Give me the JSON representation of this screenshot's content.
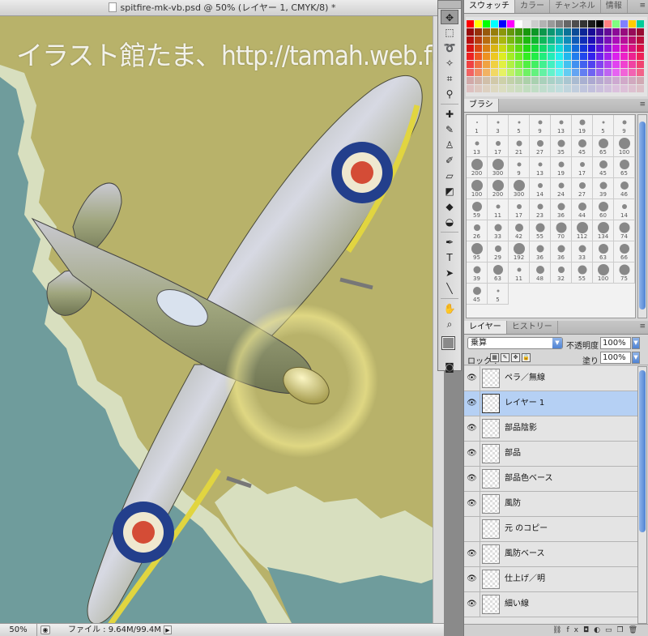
{
  "document": {
    "title": "spitfire-mk-vb.psd @ 50% (レイヤー 1, CMYK/8) *",
    "watermark": "イラスト館たま、http://tamah.web.fc2.com/il.html",
    "zoom": "50%",
    "file_info": "ファイル : 9.64M/99.4M"
  },
  "tools": {
    "icons": [
      "move-icon",
      "marquee-icon",
      "lasso-icon",
      "magic-wand-icon",
      "crop-icon",
      "eyedropper-icon",
      "healing-brush-icon",
      "brush-icon",
      "clone-stamp-icon",
      "history-brush-icon",
      "eraser-icon",
      "paint-bucket-icon",
      "blur-icon",
      "dodge-icon",
      "pen-icon",
      "type-icon",
      "path-select-icon",
      "line-icon",
      "hand-icon",
      "zoom-icon"
    ]
  },
  "swatches_panel": {
    "tabs": [
      "スウォッチ",
      "カラー",
      "チャンネル",
      "情報"
    ],
    "active_tab": 0
  },
  "brush_panel": {
    "tab": "ブラシ",
    "sizes": [
      "1",
      "3",
      "5",
      "9",
      "13",
      "19",
      "5",
      "9",
      "13",
      "17",
      "21",
      "27",
      "35",
      "45",
      "65",
      "100",
      "200",
      "300",
      "9",
      "13",
      "19",
      "17",
      "45",
      "65",
      "100",
      "200",
      "300",
      "14",
      "24",
      "27",
      "39",
      "46",
      "59",
      "11",
      "17",
      "23",
      "36",
      "44",
      "60",
      "14",
      "26",
      "33",
      "42",
      "55",
      "70",
      "112",
      "134",
      "74",
      "95",
      "29",
      "192",
      "36",
      "36",
      "33",
      "63",
      "66",
      "39",
      "63",
      "11",
      "48",
      "32",
      "55",
      "100",
      "75",
      "45",
      "5"
    ]
  },
  "layers_panel": {
    "tabs": [
      "レイヤー",
      "ヒストリー"
    ],
    "active_tab": 0,
    "blend_mode": "乗算",
    "opacity_label": "不透明度 :",
    "opacity": "100%",
    "lock_label": "ロック :",
    "fill_label": "塗り :",
    "fill": "100%",
    "layers": [
      {
        "name": "ペラ／無線",
        "visible": true,
        "active": false
      },
      {
        "name": "レイヤー 1",
        "visible": true,
        "active": true
      },
      {
        "name": "部品陰影",
        "visible": true,
        "active": false
      },
      {
        "name": "部品",
        "visible": true,
        "active": false
      },
      {
        "name": "部品色ベース",
        "visible": true,
        "active": false
      },
      {
        "name": "風防",
        "visible": true,
        "active": false
      },
      {
        "name": "元 のコピー",
        "visible": false,
        "active": false
      },
      {
        "name": "風防ベース",
        "visible": true,
        "active": false
      },
      {
        "name": "仕上げ／明",
        "visible": true,
        "active": false
      },
      {
        "name": "細い線",
        "visible": true,
        "active": false
      }
    ],
    "footer_icons": [
      "link-icon",
      "fx-icon",
      "mask-icon",
      "adjustment-icon",
      "group-icon",
      "new-layer-icon",
      "trash-icon"
    ]
  },
  "colors": {
    "sea": "#6f9c9c",
    "land_light": "#d8dfbf",
    "land_olive": "#b8b26a",
    "selection": "#b5d0f4",
    "accent_blue": "#4f83d4"
  }
}
